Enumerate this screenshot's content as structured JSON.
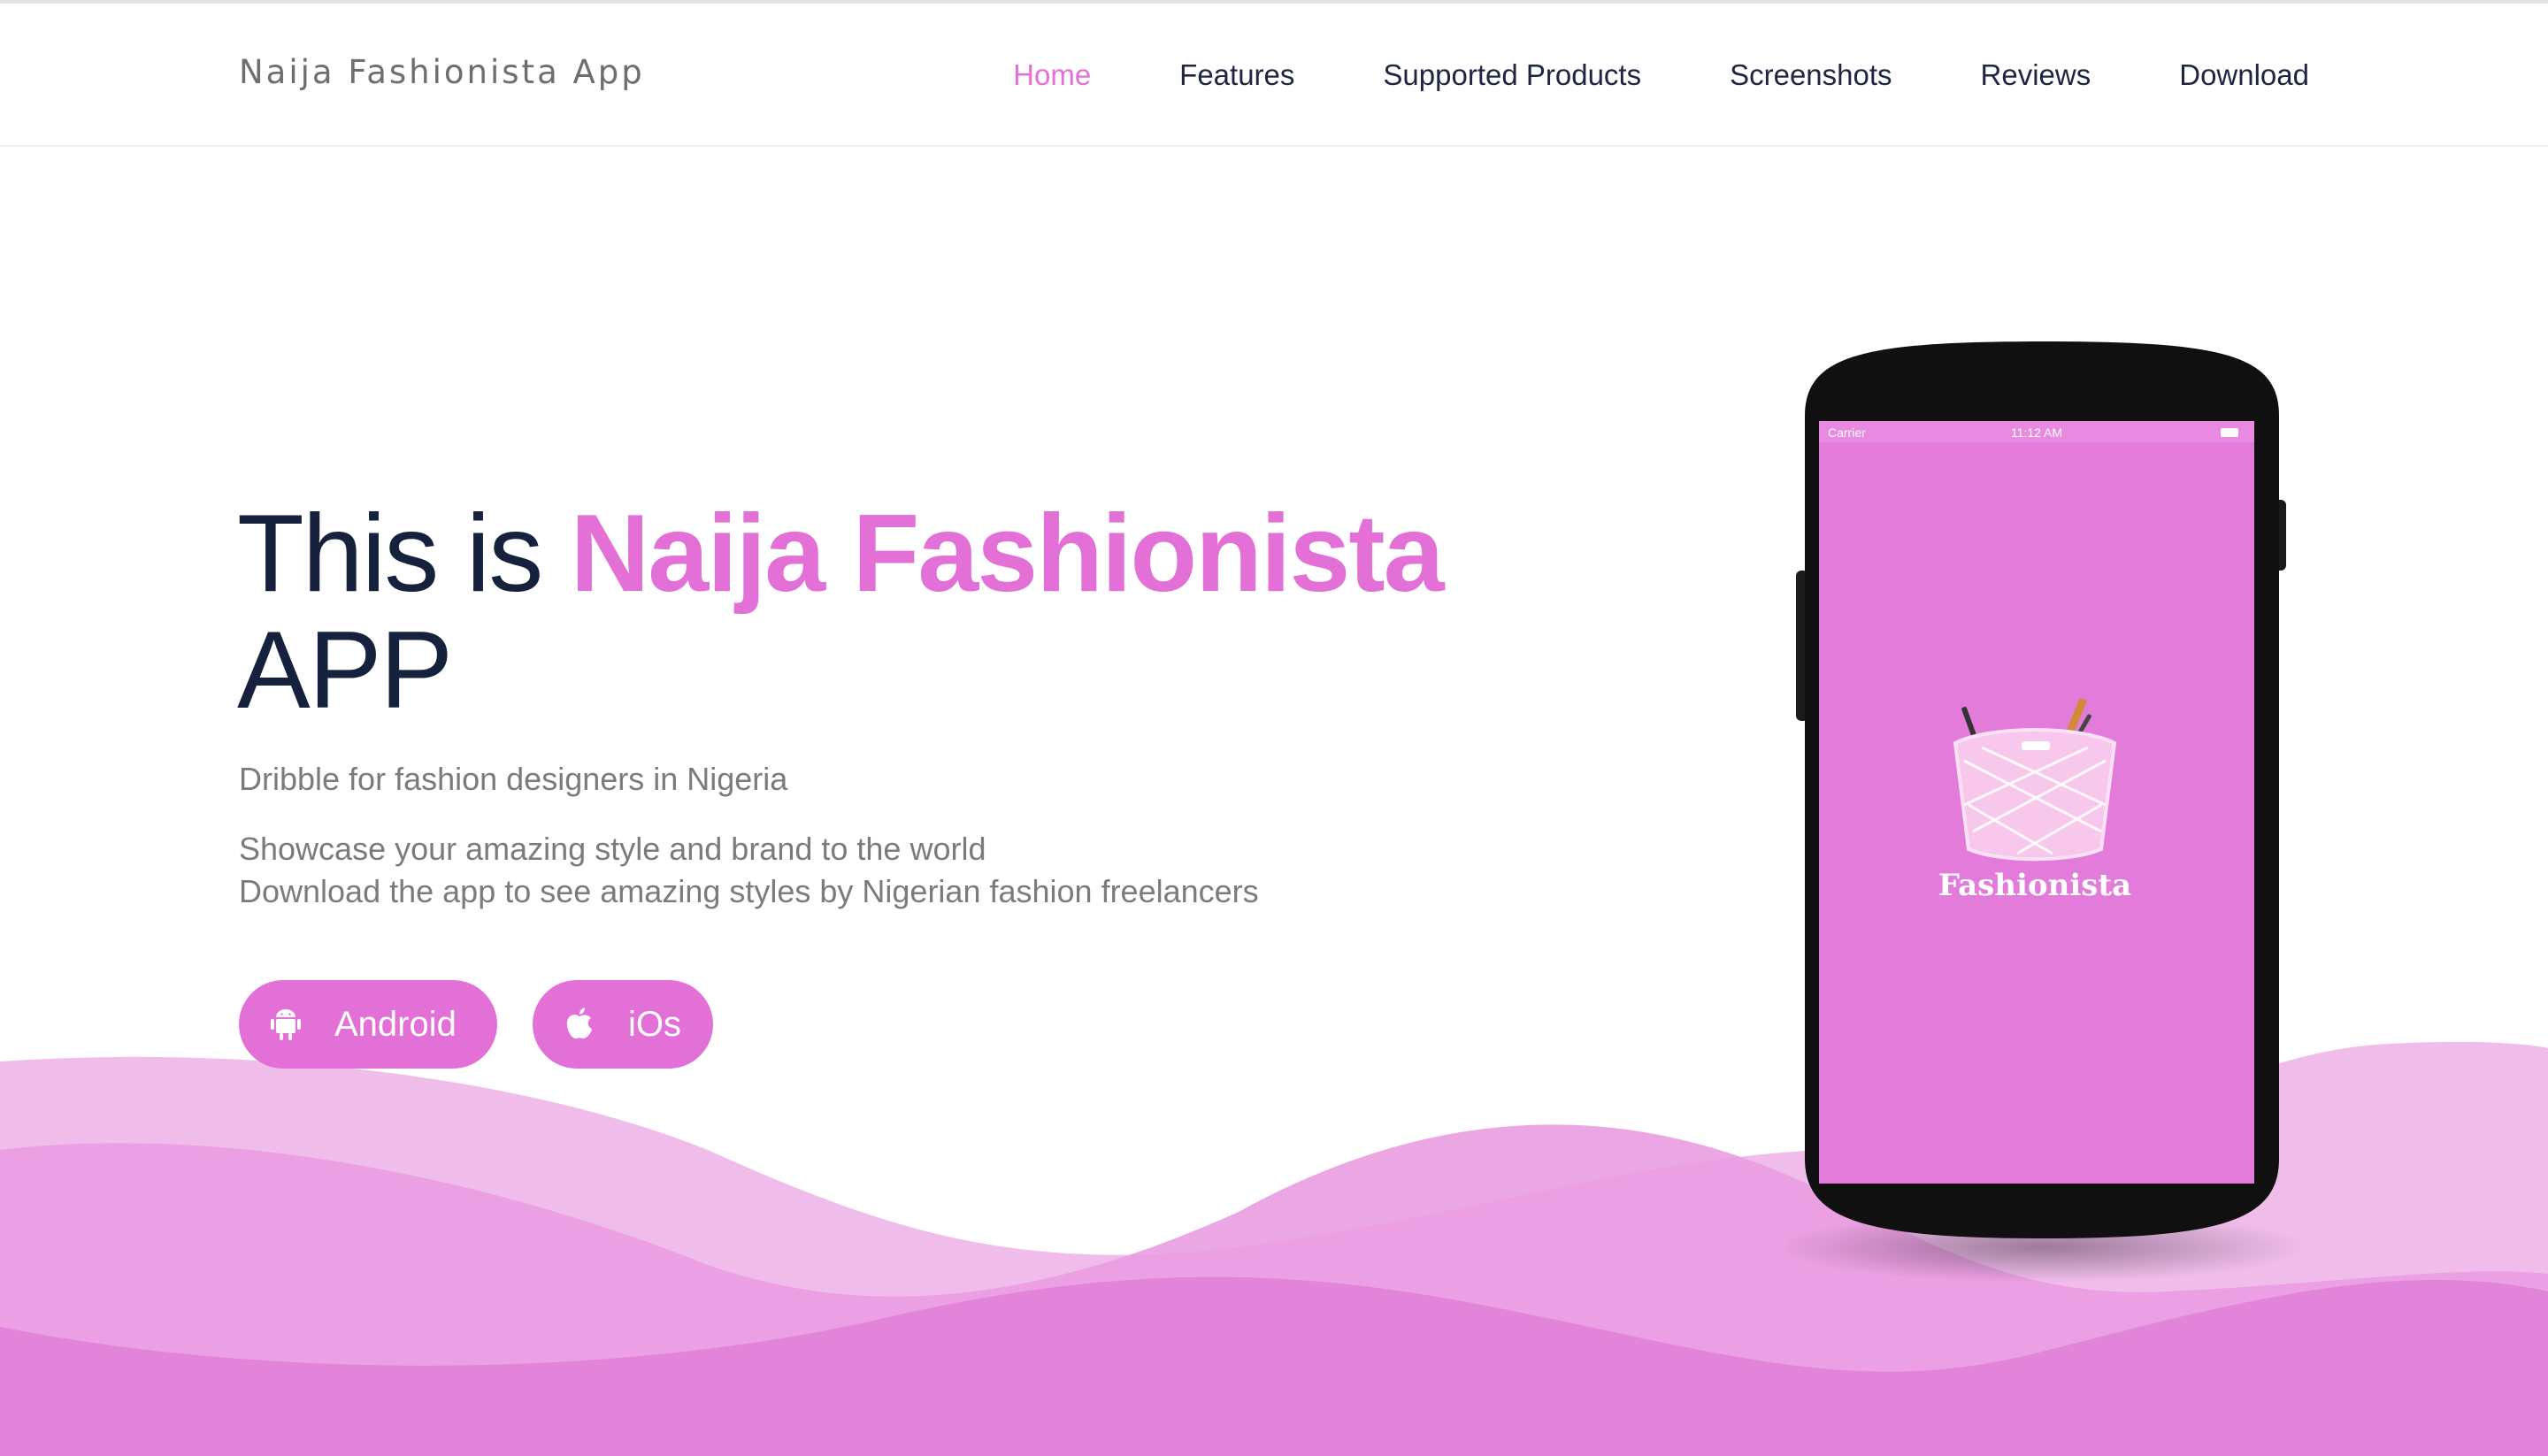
{
  "header": {
    "brand": "Naija Fashionista App",
    "nav": [
      {
        "label": "Home",
        "active": true
      },
      {
        "label": "Features",
        "active": false
      },
      {
        "label": "Supported Products",
        "active": false
      },
      {
        "label": "Screenshots",
        "active": false
      },
      {
        "label": "Reviews",
        "active": false
      },
      {
        "label": "Download",
        "active": false
      }
    ]
  },
  "hero": {
    "title_prefix": "This is",
    "title_accent": "Naija Fashionista",
    "title_suffix": "APP",
    "tagline": "Dribble for fashion designers in Nigeria",
    "description_line1": "Showcase your amazing style and brand to the world",
    "description_line2": "Download the app to see amazing styles by Nigerian fashion freelancers",
    "buttons": {
      "android": {
        "label": "Android",
        "icon": "android-icon"
      },
      "ios": {
        "label": "iOs",
        "icon": "apple-icon"
      }
    }
  },
  "phone": {
    "status_carrier": "Carrier",
    "status_time": "11:12 AM",
    "app_name": "Fashionista"
  },
  "colors": {
    "accent": "#e270d6",
    "heading": "#15213d",
    "body_text": "#7b7b7b",
    "nav_text": "#1c2640"
  }
}
